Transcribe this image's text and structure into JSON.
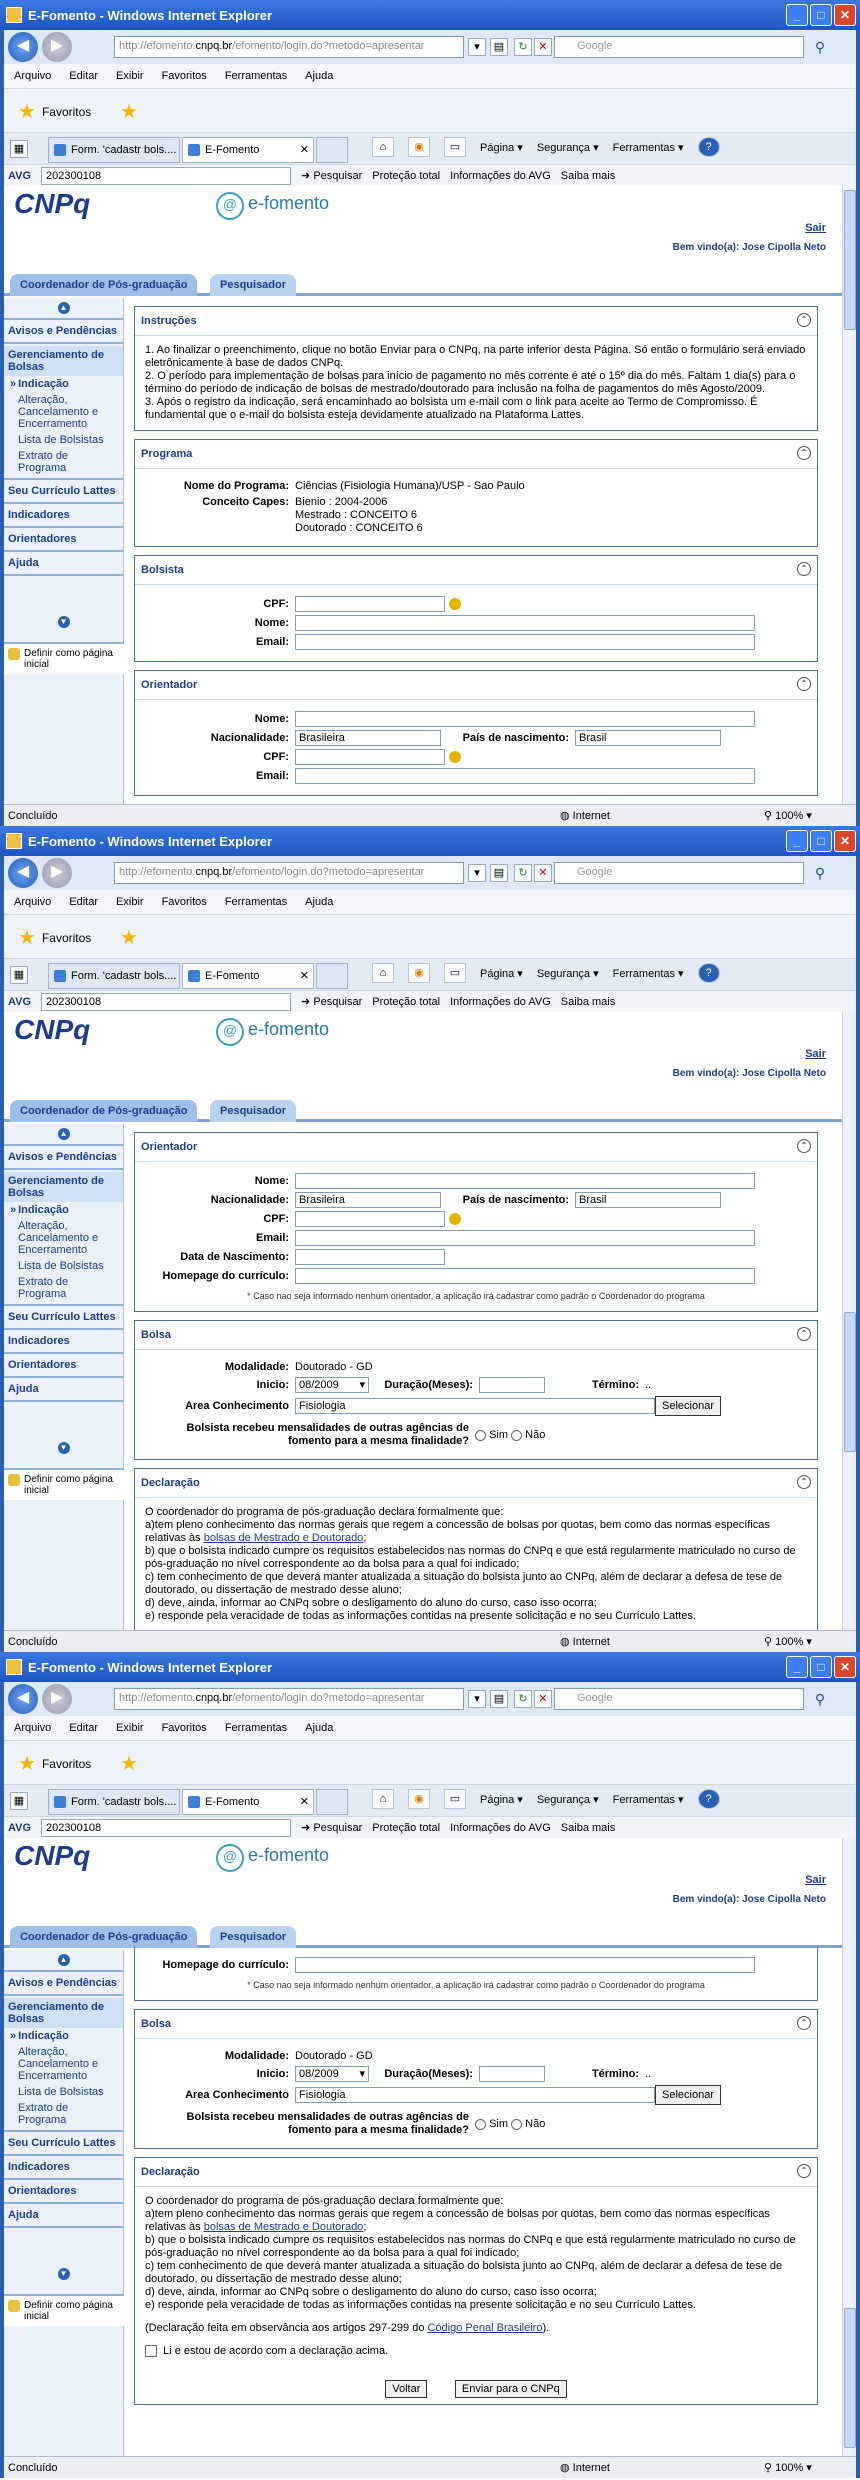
{
  "window": {
    "title": "E-Fomento - Windows Internet Explorer",
    "url_pre": "http://efomento.",
    "url_dom": "cnpq.br",
    "url_post": "/efomento/login.do?metodo=apresentar",
    "search_placeholder": "Google"
  },
  "menu": [
    "Arquivo",
    "Editar",
    "Exibir",
    "Favoritos",
    "Ferramentas",
    "Ajuda"
  ],
  "favorites": "Favoritos",
  "tabs": {
    "t1": "Form. 'cadastr bols....",
    "t1b": "Form. 'cadastr bols....",
    "t2": "E-Fomento"
  },
  "tools": {
    "pagina": "Página ▾",
    "seguranca": "Segurança ▾",
    "ferramentas": "Ferramentas ▾"
  },
  "avg": {
    "label": "AVG",
    "field": "202300108",
    "pesquisar": "Pesquisar",
    "protecao": "Proteção total",
    "info": "Informações do AVG",
    "saiba": "Saiba mais"
  },
  "status": {
    "done": "Concluído",
    "internet": "Internet",
    "zoom": "100%"
  },
  "header": {
    "logo": "CNPq",
    "app": "e-fomento",
    "sair": "Sair",
    "welcome": "Bem vindo(a): Jose Cipolla Neto"
  },
  "ctabs": {
    "coord": "Coordenador de Pós-graduação",
    "pesq": "Pesquisador"
  },
  "side": {
    "avisos": "Avisos e Pendências",
    "gerenciamento": "Gerenciamento de Bolsas",
    "indicacao": "Indicação",
    "alteracao": "Alteração, Cancelamento e Encerramento",
    "lista": "Lista de Bolsistas",
    "extrato": "Extrato de Programa",
    "curriculo": "Seu Currículo Lattes",
    "indicadores": "Indicadores",
    "orientadores": "Orientadores",
    "ajuda": "Ajuda",
    "definir": "Definir como página inicial"
  },
  "instrucoes": {
    "title": "Instruções",
    "p1": "1. Ao finalizar o preenchimento, clique no botão Enviar para o CNPq, na parte inferior desta Página. Só então o formulário será enviado eletrônicamente à base de dados CNPq.",
    "p2": "2. O período para implementação de bolsas para início de pagamento no mês corrente é até o 15º dia do mês. Faltam 1 dia(s) para o término do período de indicação de bolsas de mestrado/doutorado para inclusão na folha de pagamentos do mês Agosto/2009.",
    "p3": "3. Após o registro da indicação, será encaminhado ao bolsista um e-mail com o link para aceite ao Termo de Compromisso. É fundamental que o e-mail do bolsista esteja devidamente atualizado na Plataforma Lattes."
  },
  "programa": {
    "title": "Programa",
    "nome_lbl": "Nome do Programa:",
    "nome": "Ciências (Fisiologia Humana)/USP - Sao Paulo",
    "conceito_lbl": "Conceito Capes:",
    "c1": "Bienio : 2004-2006",
    "c2": "Mestrado : CONCEITO 6",
    "c3": "Doutorado : CONCEITO 6"
  },
  "bolsista": {
    "title": "Bolsista",
    "cpf": "CPF:",
    "nome": "Nome:",
    "email": "Email:"
  },
  "orientador": {
    "title": "Orientador",
    "nome": "Nome:",
    "nacionalidade": "Nacionalidade:",
    "nac_val": "Brasileira",
    "pais_lbl": "País de nascimento:",
    "pais_val": "Brasil",
    "cpf": "CPF:",
    "email": "Email:",
    "data_nasc": "Data de Nascimento:",
    "homepage": "Homepage do currículo:",
    "note": "* Caso nao seja informado nenhum orientador, a aplicação irá cadastrar como padrão o Coordenador do programa"
  },
  "bolsa": {
    "title": "Bolsa",
    "mod_lbl": "Modalidade:",
    "mod": "Doutorado - GD",
    "inicio_lbl": "Inicio:",
    "inicio": "08/2009",
    "duracao_lbl": "Duração(Meses):",
    "termino_lbl": "Término:",
    "termino": "..",
    "area_lbl": "Area Conhecimento",
    "area": "Fisiologia",
    "selecionar": "Selecionar",
    "q": "Bolsista recebeu mensalidades de outras agências de fomento para a mesma finalidade?",
    "sim": "Sim",
    "nao": "Não"
  },
  "declaracao": {
    "title": "Declaração",
    "l1": "O coordenador do programa de pós-graduação declara formalmente que:",
    "l2a": "a)tem pleno conhecimento das normas gerais que regem a concessão de bolsas por quotas, bem como das normas específicas relativas às ",
    "l2link": "bolsas de Mestrado e Doutorado",
    "l3": "b) que o bolsista indicado cumpre os requisitos estabelecidos nas normas do CNPq e que está regularmente matriculado no curso de pós-graduação no nível correspondente ao da bolsa para a qual foi indicado;",
    "l4": "c) tem conhecimento de que deverá manter atualizada a situação do bolsista junto ao CNPq, além de declarar a defesa de tese de doutorado, ou dissertação de mestrado desse aluno;",
    "l5": "d) deve, ainda, informar ao CNPq sobre o desligamento do aluno do curso, caso isso ocorra;",
    "l6": "e) responde pela veracidade de todas as informações contidas na presente solicitação e no seu Currículo Lattes.",
    "obs_a": "(Declaração feita em observância aos artigos 297-299 do ",
    "obs_link": "Código Penal Brasileiro",
    "obs_b": ").",
    "aceite": "Li e estou de acordo com a declaração acima.",
    "voltar": "Voltar",
    "enviar": "Enviar para o CNPq"
  }
}
